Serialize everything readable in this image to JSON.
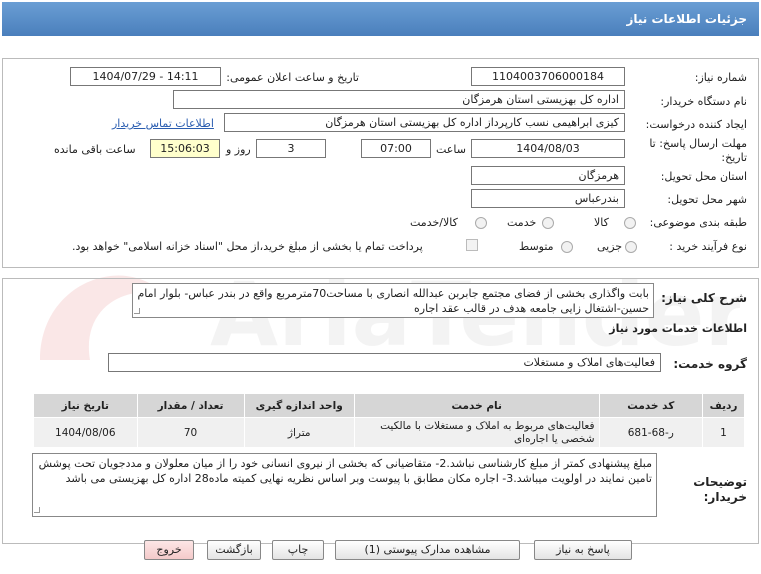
{
  "header": {
    "title": "جزئیات اطلاعات نیاز"
  },
  "fields": {
    "need_number_label": "شماره نیاز:",
    "need_number": "1104003706000184",
    "announce_label": "تاریخ و ساعت اعلان عمومی:",
    "announce_value": "1404/07/29 - 14:11",
    "buyer_label": "نام دستگاه خریدار:",
    "buyer_value": "اداره کل بهزیستی استان هرمزگان",
    "creator_label": "ایجاد کننده درخواست:",
    "creator_value": "کیزی  ابراهیمی نسب کارپرداز اداره کل بهزیستی استان هرمزگان",
    "contact_link": "اطلاعات تماس خریدار",
    "deadline_label_1": "مهلت ارسال پاسخ: تا",
    "deadline_label_2": "تاریخ:",
    "deadline_date": "1404/08/03",
    "time_label": "ساعت",
    "deadline_time": "07:00",
    "days_value": "3",
    "days_label": "روز و",
    "remaining_time": "15:06:03",
    "remaining_label": "ساعت باقی مانده",
    "province_label": "استان محل تحویل:",
    "province_value": "هرمزگان",
    "city_label": "شهر محل تحویل:",
    "city_value": "بندرعباس",
    "category_label": "طبقه بندی موضوعی:",
    "category_options": [
      "کالا",
      "خدمت",
      "کالا/خدمت"
    ],
    "category_selected": "خدمت",
    "process_label": "نوع فرآیند خرید :",
    "process_options": [
      "جزیی",
      "متوسط"
    ],
    "process_note": "پرداخت تمام یا بخشی از مبلغ خرید،از محل \"اسناد خزانه اسلامی\" خواهد بود."
  },
  "summary": {
    "label": "شرح کلی نیاز:",
    "text": "بابت واگذاری بخشی از فضای مجتمع جابربن عبدالله انصاری با مساحت70مترمربع  واقع در بندر عباس- بلوار امام حسین-اشتغال زایی جامعه هدف در قالب عقد اجاره"
  },
  "services": {
    "title": "اطلاعات خدمات مورد نیاز",
    "group_label": "گروه خدمت:",
    "group_value": "فعالیت‌های  املاک و مستغلات",
    "columns": [
      "ردیف",
      "کد خدمت",
      "نام خدمت",
      "واحد اندازه گیری",
      "تعداد / مقدار",
      "تاریخ نیاز"
    ],
    "rows": [
      [
        "1",
        "ر-68-681",
        "فعالیت‌های مربوط به املاک و مستغلات با مالکیت شخصی یا اجاره‌ای",
        "متراژ",
        "70",
        "1404/08/06"
      ]
    ]
  },
  "buyer_notes": {
    "label_1": "توضیحات",
    "label_2": "خریدار:",
    "text": "مبلغ پیشنهادی کمتر از مبلغ کارشناسی نباشد.2- متقاضیانی که بخشی از نیروی انسانی خود را از میان معلولان و مددجویان تحت پوشش تامین نمایند در اولویت میباشد.3-  اجاره مکان  مطابق با پیوست وبر اساس نظریه نهایی کمیته ماده28 اداره کل بهزیستی می باشد"
  },
  "buttons": {
    "reply": "پاسخ به نیاز",
    "view_docs": "مشاهده مدارک پیوستی (1)",
    "print": "چاپ",
    "back": "بازگشت",
    "exit": "خروج"
  },
  "watermark": {
    "text": "AriaTender.net"
  }
}
